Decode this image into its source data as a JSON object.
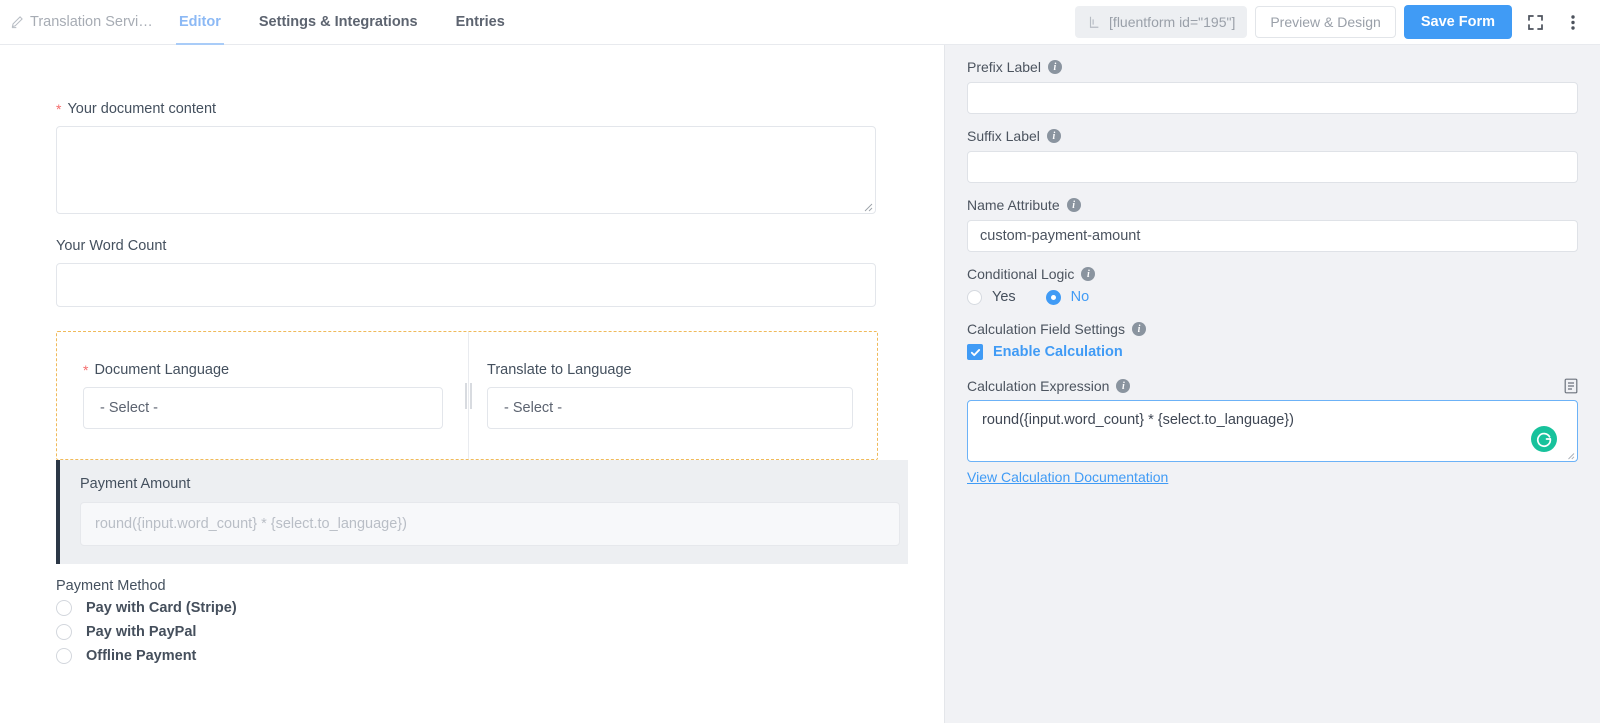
{
  "topbar": {
    "brand": "Translation Servi…",
    "tabs": [
      {
        "label": "Editor",
        "active": true
      },
      {
        "label": "Settings & Integrations",
        "active": false
      },
      {
        "label": "Entries",
        "active": false
      }
    ],
    "shortcode": "[fluentform id=\"195\"]",
    "preview_label": "Preview & Design",
    "save_label": "Save Form",
    "accent_color": "#409bf5",
    "active_tab_color": "#8cb9f5"
  },
  "canvas": {
    "fields": [
      {
        "label": "Your document content",
        "required": true,
        "type": "textarea",
        "value": ""
      },
      {
        "label": "Your Word Count",
        "required": false,
        "type": "text",
        "value": ""
      }
    ],
    "language_container": {
      "left": {
        "label": "Document Language",
        "required": true,
        "value": "- Select -"
      },
      "right": {
        "label": "Translate to Language",
        "required": false,
        "value": "- Select -"
      },
      "border_color": "#f0ba5a"
    },
    "payment_amount": {
      "label": "Payment Amount",
      "placeholder": "round({input.word_count} * {select.to_language})",
      "accent_color": "#2b3746"
    },
    "payment_method": {
      "label": "Payment Method",
      "options": [
        "Pay with Card (Stripe)",
        "Pay with PayPal",
        "Offline Payment"
      ]
    }
  },
  "sidepanel": {
    "prefix_label": {
      "label": "Prefix Label",
      "value": ""
    },
    "suffix_label": {
      "label": "Suffix Label",
      "value": ""
    },
    "name_attribute": {
      "label": "Name Attribute",
      "value": "custom-payment-amount"
    },
    "conditional_logic": {
      "label": "Conditional Logic",
      "options": [
        {
          "label": "Yes",
          "selected": false
        },
        {
          "label": "No",
          "selected": true
        }
      ]
    },
    "calculation_settings": {
      "label": "Calculation Field Settings",
      "checkbox_label": "Enable Calculation",
      "checked": true
    },
    "calculation_expression": {
      "label": "Calculation Expression",
      "value": "round({input.word_count} * {select.to_language})",
      "doc_link": "View Calculation Documentation",
      "focus_color": "#6cb2f7",
      "grammarly_color": "#18c29c"
    }
  }
}
